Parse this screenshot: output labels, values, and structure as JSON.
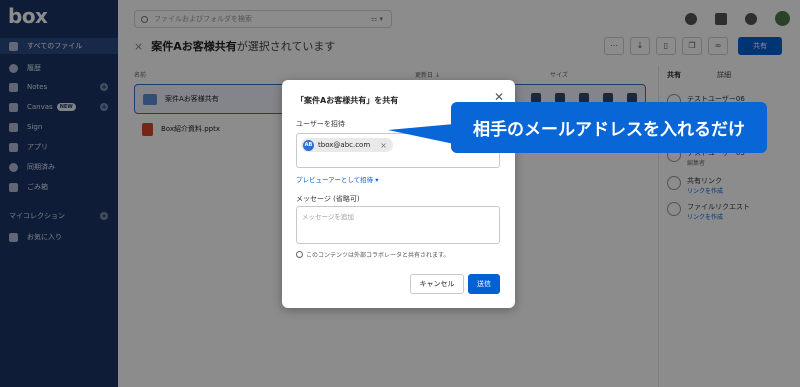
{
  "app": {
    "logo": "box"
  },
  "sidebar": {
    "items": [
      {
        "label": "すべてのファイル",
        "icon": "folder-icon",
        "active": true,
        "plus": false
      },
      {
        "label": "履歴",
        "icon": "clock-icon",
        "active": false,
        "plus": false
      },
      {
        "label": "Notes",
        "icon": "notes-icon",
        "active": false,
        "plus": true
      },
      {
        "label": "Canvas",
        "icon": "canvas-icon",
        "active": false,
        "plus": true,
        "badge": "NEW"
      },
      {
        "label": "Sign",
        "icon": "sign-icon",
        "active": false,
        "plus": false
      },
      {
        "label": "アプリ",
        "icon": "apps-icon",
        "active": false,
        "plus": false
      },
      {
        "label": "同期済み",
        "icon": "sync-icon",
        "active": false,
        "plus": false
      },
      {
        "label": "ごみ箱",
        "icon": "trash-icon",
        "active": false,
        "plus": false
      },
      {
        "label": "マイコレクション",
        "icon": "",
        "active": false,
        "plus": true
      },
      {
        "label": "お気に入り",
        "icon": "star-icon",
        "active": false,
        "plus": false
      }
    ]
  },
  "header": {
    "search_placeholder": "ファイルおよびフォルダを検索",
    "filter_label": "⚏ ▾"
  },
  "content": {
    "title_x": "×",
    "folder_name": "案件Aお客様共有",
    "selected_suffix": "が選択されています",
    "share_button": "共有",
    "col_name": "名前",
    "col_updated": "更新日 ↓",
    "col_size": "サイズ",
    "files": [
      {
        "name": "案件Aお客様共有",
        "type": "folder"
      },
      {
        "name": "Box紹介資料.pptx",
        "type": "pptx"
      }
    ]
  },
  "right_panel": {
    "tab_share": "共有",
    "tab_details": "詳細",
    "user1_name": "テストユーザー06",
    "user2_role": "編集者",
    "user2_name": "テストユーザー03",
    "share_link_title": "共有リンク",
    "share_link_action": "リンクを作成",
    "file_request_title": "ファイルリクエスト",
    "file_request_action": "リンクを作成"
  },
  "modal": {
    "title": "「案件Aお客様共有」を共有",
    "invite_label": "ユーザーを招待",
    "chip_initials": "AB",
    "chip_email": "tbox@abc.com",
    "chip_remove": "×",
    "invite_role_link": "プレビューアーとして招待 ▾",
    "message_label": "メッセージ (省略可)",
    "message_placeholder": "メッセージを追加",
    "external_note": "このコンテンツは外部コラボレータと共有されます。",
    "cancel_button": "キャンセル",
    "send_button": "送信",
    "close": "✕"
  },
  "callout": {
    "text": "相手のメールアドレスを入れるだけ"
  },
  "colors": {
    "sidebar": "#1b3466",
    "accent": "#0061d5",
    "callout": "#0866d6"
  }
}
